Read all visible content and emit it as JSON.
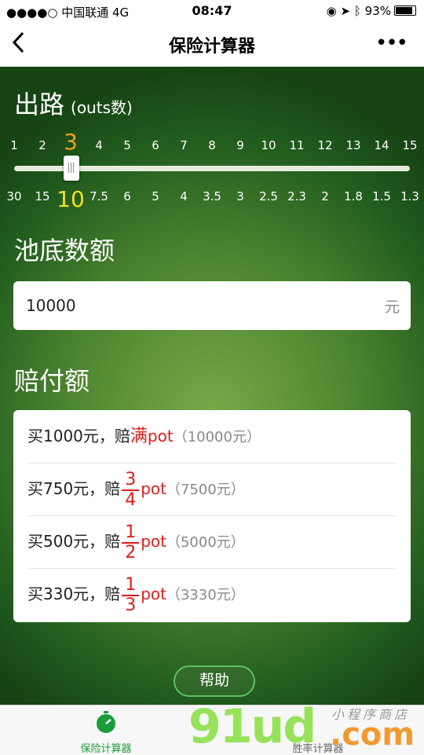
{
  "status": {
    "carrier": "●●●●○ 中国联通  4G",
    "time": "08:47",
    "battery": "93%"
  },
  "nav": {
    "title": "保险计算器",
    "back": "<",
    "more": "•••"
  },
  "outs": {
    "title": "出路",
    "subtitle": "(outs数)",
    "top_ticks": [
      "1",
      "2",
      "3",
      "4",
      "5",
      "6",
      "7",
      "8",
      "9",
      "10",
      "11",
      "12",
      "13",
      "14",
      "15"
    ],
    "bottom_ticks": [
      "30",
      "15",
      "10",
      "7.5",
      "6",
      "5",
      "4",
      "3.5",
      "3",
      "2.5",
      "2.3",
      "2",
      "1.8",
      "1.5",
      "1.3"
    ],
    "selected_index": 2
  },
  "pot": {
    "title": "池底数额",
    "value": "10000",
    "unit": "元"
  },
  "payout": {
    "title": "赔付额",
    "rows": [
      {
        "buy": "买1000元，赔",
        "full": "满",
        "pot": "pot",
        "total": "（10000元）"
      },
      {
        "buy": "买750元，赔",
        "num": "3",
        "den": "4",
        "pot": "pot",
        "total": "（7500元）"
      },
      {
        "buy": "买500元，赔",
        "num": "1",
        "den": "2",
        "pot": "pot",
        "total": "（5000元）"
      },
      {
        "buy": "买330元，赔",
        "num": "1",
        "den": "3",
        "pot": "pot",
        "total": "（3330元）"
      }
    ]
  },
  "help_label": "帮助",
  "tabs": [
    {
      "label": "保险计算器",
      "active": true,
      "color": "#1a9c3a"
    },
    {
      "label": "胜率计算器",
      "active": false,
      "color": "#666666"
    }
  ],
  "watermark": {
    "text": "91ud",
    "suffix": ".com",
    "cn": "小程序商店"
  }
}
